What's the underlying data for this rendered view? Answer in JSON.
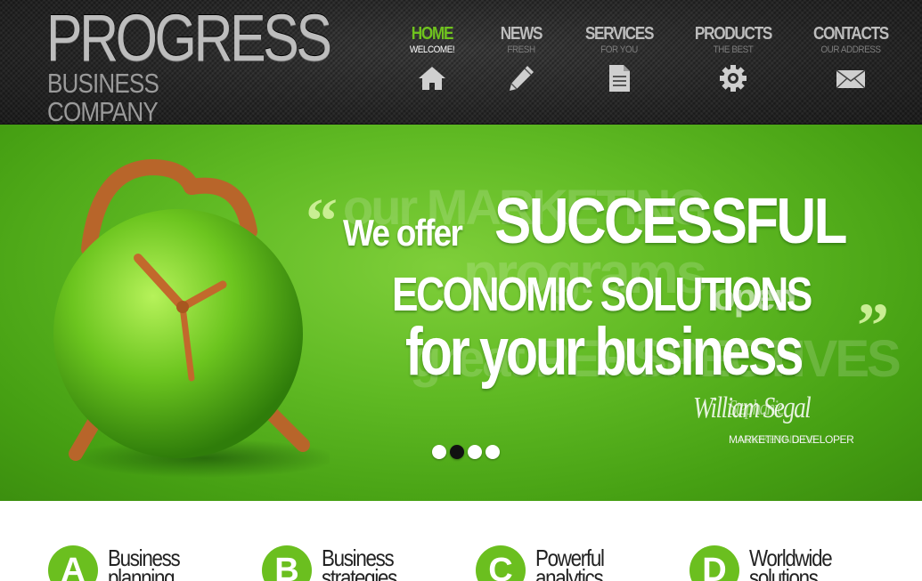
{
  "logo": {
    "title": "PROGRESS",
    "subtitle": "BUSINESS COMPANY"
  },
  "nav": {
    "items": [
      {
        "label": "HOME",
        "sub": "WELCOME!",
        "icon": "home-icon",
        "active": true
      },
      {
        "label": "NEWS",
        "sub": "FRESH",
        "icon": "pencil-icon",
        "active": false
      },
      {
        "label": "SERVICES",
        "sub": "FOR YOU",
        "icon": "document-icon",
        "active": false
      },
      {
        "label": "PRODUCTS",
        "sub": "THE BEST",
        "icon": "gear-icon",
        "active": false
      },
      {
        "label": "CONTACTS",
        "sub": "OUR ADDRESS",
        "icon": "envelope-icon",
        "active": false
      }
    ]
  },
  "hero": {
    "slogan_line1_a": "We offer",
    "slogan_line1_b": "SUCCESSFUL",
    "slogan_line2": "ECONOMIC SOLUTIONS",
    "slogan_line3": "for your business",
    "ghost_line1": "our MARKETING",
    "ghost_line2": "programs",
    "ghost_line3": "open",
    "ghost_line4": "great PERSPECTIVES",
    "quote_open": "“",
    "quote_close": "”",
    "signature": "William Segal",
    "signature_ghost": "Stephanie",
    "author_title": "MARKETING DEVELOPER",
    "author_title_ghost": "MARKETING DE",
    "slider_dots": 4,
    "active_dot": 2
  },
  "features": [
    {
      "letter": "A",
      "title": "Business planning"
    },
    {
      "letter": "B",
      "title": "Business strategies"
    },
    {
      "letter": "C",
      "title": "Powerful analytics"
    },
    {
      "letter": "D",
      "title": "Worldwide solutions"
    }
  ],
  "colors": {
    "accent_green": "#6fc21e",
    "hero_green": "#5fb923",
    "header_dark": "#262626"
  }
}
